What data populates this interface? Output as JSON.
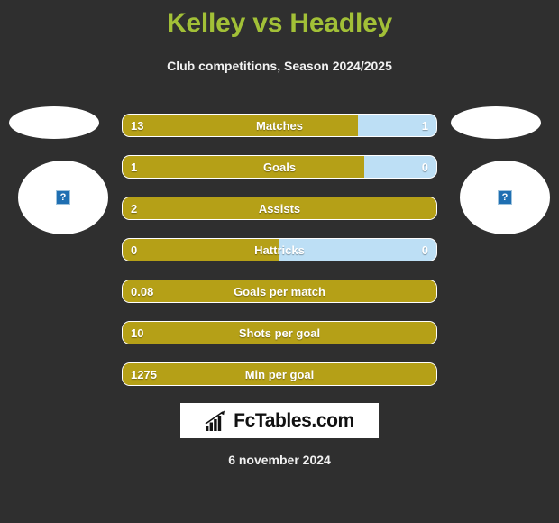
{
  "header": {
    "title": "Kelley vs Headley",
    "subtitle": "Club competitions, Season 2024/2025",
    "title_color": "#a2c037"
  },
  "colors": {
    "background": "#2f2f2f",
    "home_bar": "#b5a017",
    "away_bar": "#bddff5",
    "bar_border": "#ffffff",
    "text": "#ffffff"
  },
  "players": {
    "home": {
      "avatar_icon": "broken-image-icon",
      "avatar_glyph": "?"
    },
    "away": {
      "avatar_icon": "broken-image-icon",
      "avatar_glyph": "?"
    }
  },
  "chart_data": {
    "type": "bar",
    "title": "Kelley vs Headley",
    "subtitle": "Club competitions, Season 2024/2025",
    "orientation": "horizontal-diverging",
    "series": [
      {
        "name": "Kelley",
        "color": "#b5a017"
      },
      {
        "name": "Headley",
        "color": "#bddff5"
      }
    ],
    "categories": [
      "Matches",
      "Goals",
      "Assists",
      "Hattricks",
      "Goals per match",
      "Shots per goal",
      "Min per goal"
    ],
    "rows": [
      {
        "label": "Matches",
        "home_value": "13",
        "away_value": "1",
        "home_pct": 75,
        "away_pct": 25,
        "show_away": true
      },
      {
        "label": "Goals",
        "home_value": "1",
        "away_value": "0",
        "home_pct": 77,
        "away_pct": 23,
        "show_away": true
      },
      {
        "label": "Assists",
        "home_value": "2",
        "away_value": "",
        "home_pct": 100,
        "away_pct": 0,
        "show_away": false
      },
      {
        "label": "Hattricks",
        "home_value": "0",
        "away_value": "0",
        "home_pct": 50,
        "away_pct": 50,
        "show_away": true
      },
      {
        "label": "Goals per match",
        "home_value": "0.08",
        "away_value": "",
        "home_pct": 100,
        "away_pct": 0,
        "show_away": false
      },
      {
        "label": "Shots per goal",
        "home_value": "10",
        "away_value": "",
        "home_pct": 100,
        "away_pct": 0,
        "show_away": false
      },
      {
        "label": "Min per goal",
        "home_value": "1275",
        "away_value": "",
        "home_pct": 100,
        "away_pct": 0,
        "show_away": false
      }
    ]
  },
  "footer": {
    "logo_text": "FcTables.com",
    "logo_icon": "bar-chart-growth-icon",
    "date": "6 november 2024"
  }
}
